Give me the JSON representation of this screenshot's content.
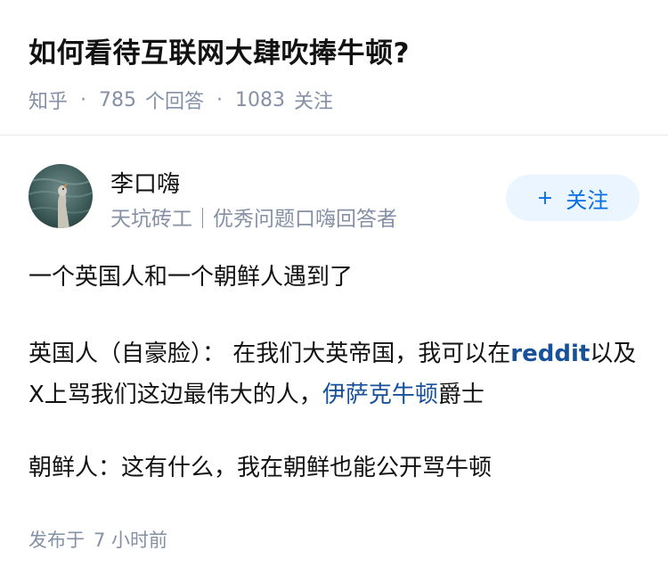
{
  "question": {
    "title": "如何看待互联网大肆吹捧牛顿?",
    "source": "知乎",
    "separator": "·",
    "answer_count": "785",
    "answer_label": "个回答",
    "follower_count": "1083",
    "follower_label": "关注"
  },
  "author": {
    "name": "李口嗨",
    "bio": "天坑砖工｜优秀问题口嗨回答者",
    "avatar_icon": "goose-avatar",
    "follow_plus": "+",
    "follow_label": "关注"
  },
  "answer": {
    "p1": "一个英国人和一个朝鲜人遇到了",
    "p2_before": "英国人（自豪脸）： 在我们大英帝国，我可以在",
    "p2_link1": "reddit",
    "p2_middle": "以及X上骂我们这边最伟大的人，",
    "p2_link2": "伊萨克牛顿",
    "p2_after": "爵士",
    "p3": "朝鲜人：这有什么，我在朝鲜也能公开骂牛顿"
  },
  "footer": {
    "publish_label": "发布于",
    "publish_time": "7 小时前"
  },
  "colors": {
    "link": "#175199",
    "follow_bg": "#ebf5ff",
    "follow_text": "#056de8",
    "meta_gray": "#8590a6"
  }
}
